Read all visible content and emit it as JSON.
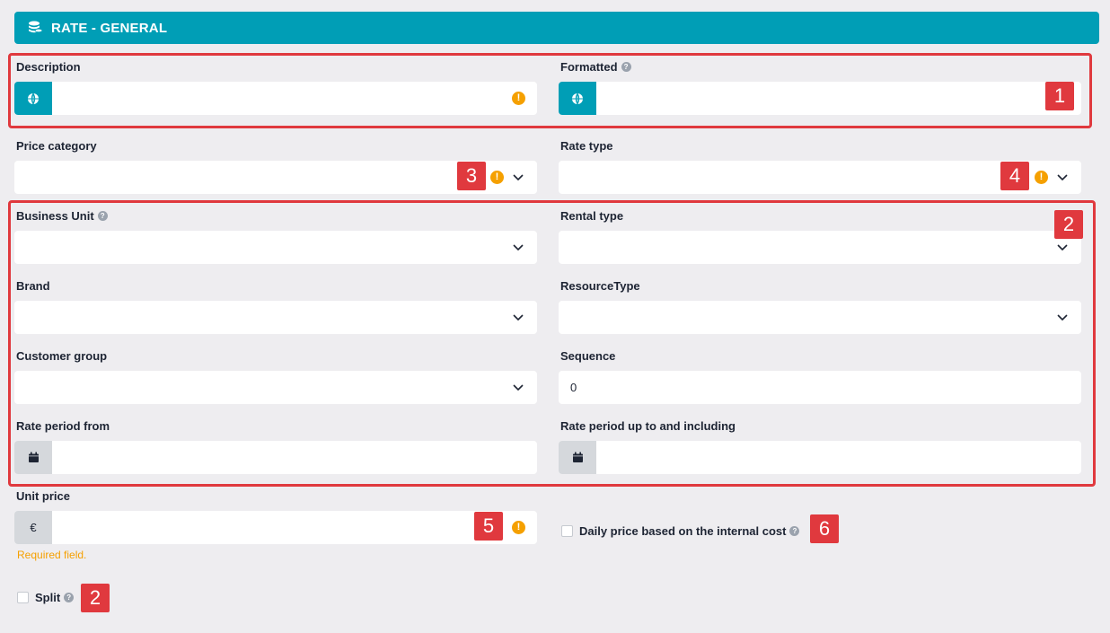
{
  "header": {
    "title": "RATE - GENERAL",
    "icon": "coins-icon"
  },
  "fields": {
    "description": {
      "label": "Description",
      "value": ""
    },
    "formatted": {
      "label": "Formatted",
      "value": ""
    },
    "price_category": {
      "label": "Price category",
      "value": ""
    },
    "rate_type": {
      "label": "Rate type",
      "value": ""
    },
    "business_unit": {
      "label": "Business Unit",
      "value": ""
    },
    "rental_type": {
      "label": "Rental type",
      "value": ""
    },
    "brand": {
      "label": "Brand",
      "value": ""
    },
    "resource_type": {
      "label": "ResourceType",
      "value": ""
    },
    "customer_group": {
      "label": "Customer group",
      "value": ""
    },
    "sequence": {
      "label": "Sequence",
      "value": "0"
    },
    "rate_period_from": {
      "label": "Rate period from",
      "value": ""
    },
    "rate_period_to": {
      "label": "Rate period up to and including",
      "value": ""
    },
    "unit_price": {
      "label": "Unit price",
      "value": "",
      "currency": "€",
      "error": "Required field."
    }
  },
  "checkboxes": {
    "daily_price": {
      "label": "Daily price based on the internal cost",
      "checked": false
    },
    "split": {
      "label": "Split",
      "checked": false
    }
  },
  "help_glyph": "?",
  "warn_glyph": "!",
  "badges": {
    "b1": "1",
    "b2_group": "2",
    "b3": "3",
    "b4": "4",
    "b5": "5",
    "b6": "6",
    "b2_split": "2"
  },
  "colors": {
    "header_bg": "#009eb6",
    "background": "#eeedf0",
    "warning": "#f5a000",
    "annotation": "#e0393e"
  }
}
